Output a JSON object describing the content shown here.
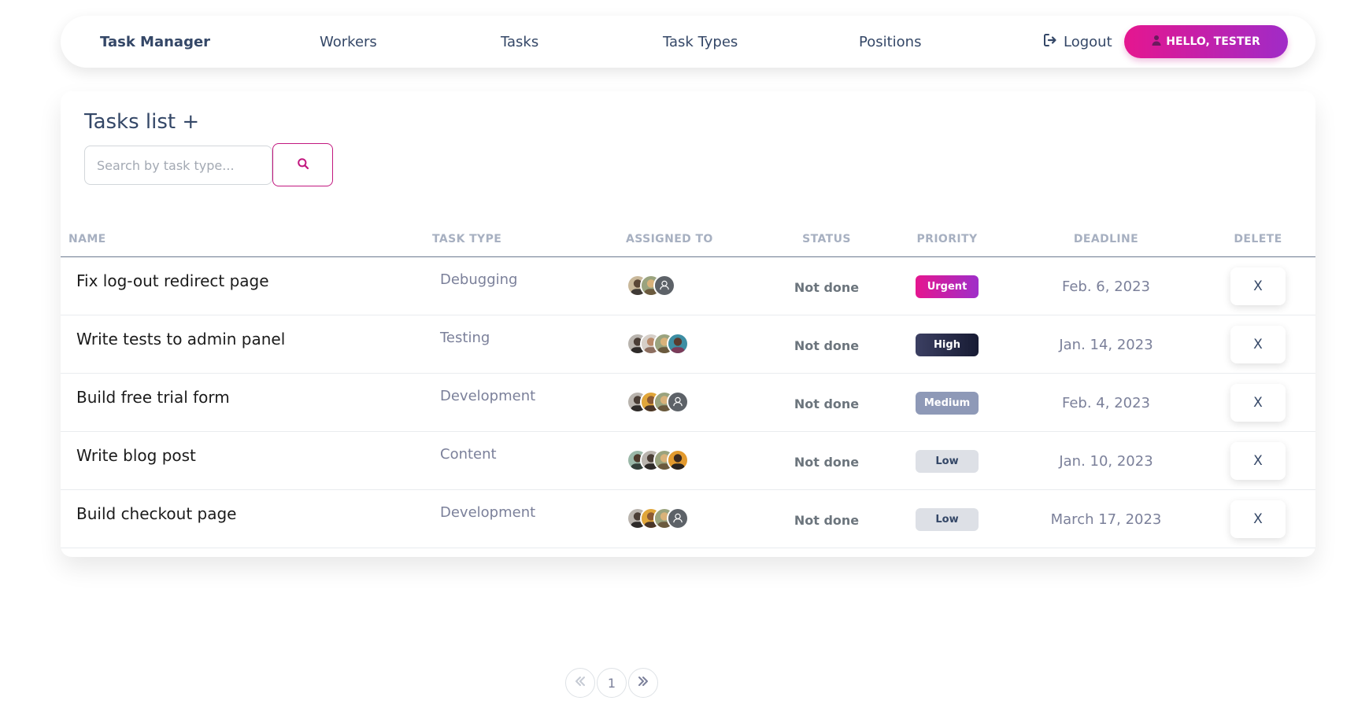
{
  "navbar": {
    "brand": "Task Manager",
    "links": [
      "Workers",
      "Tasks",
      "Task Types",
      "Positions"
    ],
    "logout_label": "Logout",
    "greeting": "HELLO, TESTER"
  },
  "page": {
    "title": "Tasks list",
    "add_symbol": "+"
  },
  "search": {
    "placeholder": "Search by task type...",
    "value": ""
  },
  "table": {
    "columns": [
      "NAME",
      "TASK TYPE",
      "ASSIGNED TO",
      "STATUS",
      "PRIORITY",
      "DEADLINE",
      "DELETE"
    ],
    "rows": [
      {
        "name": "Fix log-out redirect page",
        "task_type": "Debugging",
        "status": "Not done",
        "priority": "Urgent",
        "deadline": "Feb. 6, 2023",
        "delete_label": "X",
        "assignees": 3
      },
      {
        "name": "Write tests to admin panel",
        "task_type": "Testing",
        "status": "Not done",
        "priority": "High",
        "deadline": "Jan. 14, 2023",
        "delete_label": "X",
        "assignees": 4
      },
      {
        "name": "Build free trial form",
        "task_type": "Development",
        "status": "Not done",
        "priority": "Medium",
        "deadline": "Feb. 4, 2023",
        "delete_label": "X",
        "assignees": 4
      },
      {
        "name": "Write blog post",
        "task_type": "Content",
        "status": "Not done",
        "priority": "Low",
        "deadline": "Jan. 10, 2023",
        "delete_label": "X",
        "assignees": 4
      },
      {
        "name": "Build checkout page",
        "task_type": "Development",
        "status": "Not done",
        "priority": "Low",
        "deadline": "March 17, 2023",
        "delete_label": "X",
        "assignees": 4
      }
    ]
  },
  "pagination": {
    "current_page": "1",
    "first_icon": "double-chevron-left-icon",
    "next_icon": "double-chevron-right-icon"
  },
  "colors": {
    "accent_start": "#e5168f",
    "accent_end": "#a02bc7",
    "text_primary": "#344767",
    "text_muted": "#7b809a",
    "priority_urgent": "#e5168f",
    "priority_high": "#1f2340",
    "priority_medium": "#8e99b7",
    "priority_low": "#dde0e6"
  }
}
